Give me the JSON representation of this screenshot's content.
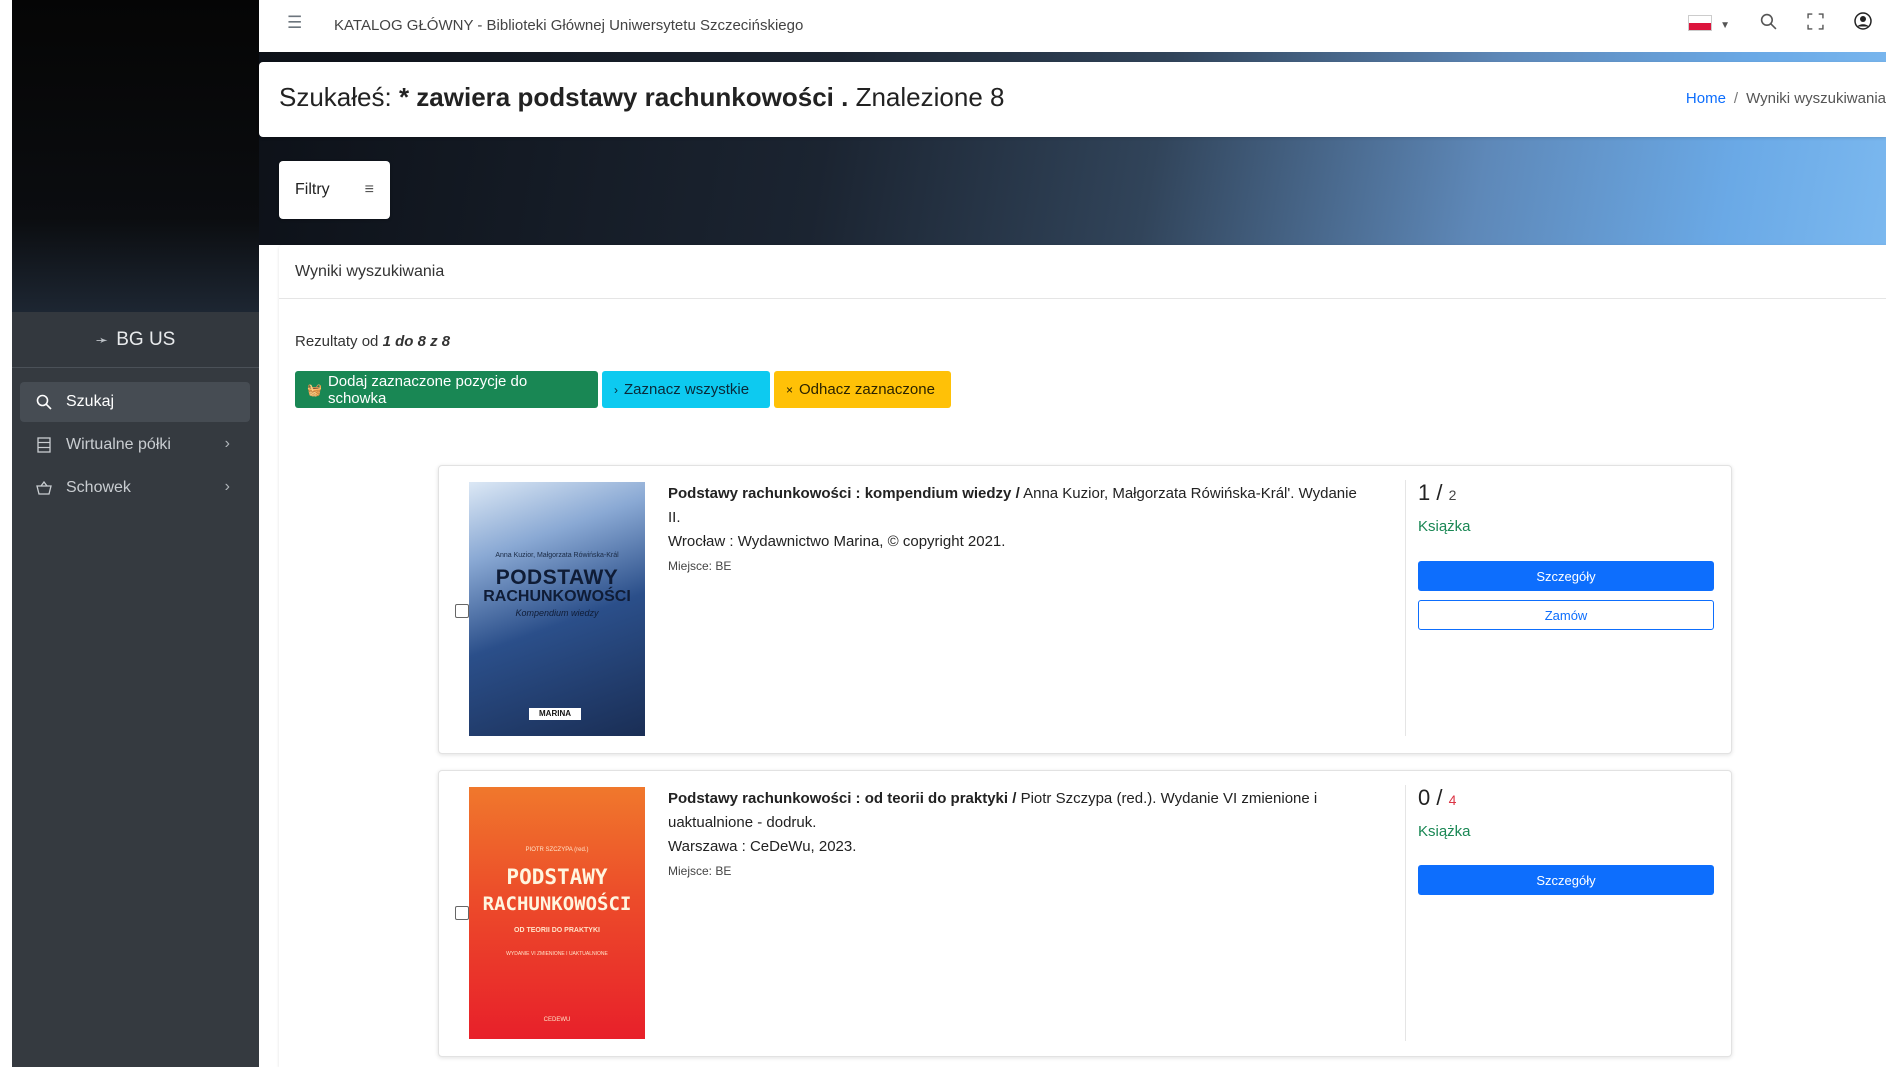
{
  "topbar": {
    "title": "KATALOG GŁÓWNY - Biblioteki Głównej Uniwersytetu Szczecińskiego"
  },
  "sidebar": {
    "brand": "BG US",
    "items": [
      {
        "label": "Szukaj",
        "icon": "search-icon",
        "active": true
      },
      {
        "label": "Wirtualne półki",
        "icon": "shelves-icon",
        "active": false
      },
      {
        "label": "Schowek",
        "icon": "basket-icon",
        "active": false
      }
    ]
  },
  "header": {
    "prefix": "Szukałeś:",
    "query": "* zawiera podstawy rachunkowości .",
    "found": "Znalezione 8",
    "breadcrumb_home": "Home",
    "breadcrumb_current": "Wyniki wyszukiwania"
  },
  "filters": {
    "label": "Filtry"
  },
  "results": {
    "title": "Wyniki wyszukiwania",
    "range_prefix": "Rezultaty od",
    "range_value": "1 do 8 z 8",
    "buttons": {
      "add": "Dodaj zaznaczone pozycje do schowka",
      "select_all": "Zaznacz wszystkie",
      "deselect": "Odhacz zaznaczone"
    },
    "items": [
      {
        "title": "Podstawy rachunkowości : kompendium wiedzy /",
        "authors": "Anna Kuzior, Małgorzata Rówińska-Král'. Wydanie II.",
        "publication": "Wrocław : Wydawnictwo Marina, © copyright 2021.",
        "place": "Miejsce: BE",
        "available": "1 /",
        "total": "2",
        "type": "Książka",
        "details": "Szczegóły",
        "order": "Zamów",
        "cover": {
          "authors": "Anna Kuzior, Małgorzata Rówińska-Král",
          "title1": "PODSTAWY",
          "title2": "RACHUNKOWOŚCI",
          "subtitle": "Kompendium wiedzy",
          "publisher": "MARINA"
        }
      },
      {
        "title": "Podstawy rachunkowości : od teorii do praktyki /",
        "authors": "Piotr Szczypa (red.). Wydanie VI zmienione i uaktualnione - dodruk.",
        "publication": "Warszawa : CeDeWu, 2023.",
        "place": "Miejsce: BE",
        "available": "0 /",
        "total": "4",
        "type": "Książka",
        "details": "Szczegóły",
        "cover": {
          "editor": "PIOTR SZCZYPA (red.)",
          "title1": "PODSTAWY",
          "title2": "RACHUNKOWOŚCI",
          "subtitle": "OD TEORII DO PRAKTYKI",
          "edition": "WYDANIE VI ZMIENIONE I UAKTUALNIONE",
          "publisher": "CEDEWU"
        }
      }
    ]
  },
  "colors": {
    "green": "#198754",
    "cyan": "#0dcaf0",
    "yellow": "#ffc107",
    "primary": "#0d6efd",
    "sidebar": "#353a40"
  }
}
